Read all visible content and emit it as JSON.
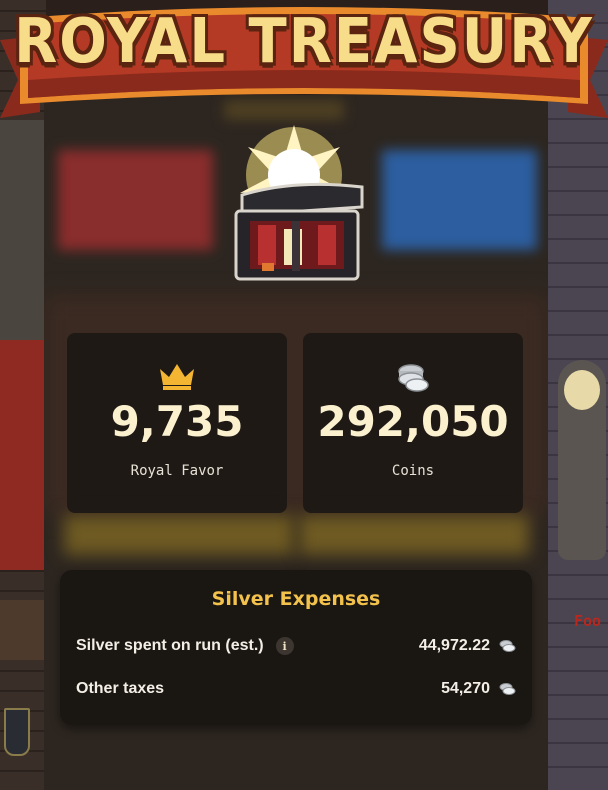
{
  "banner": {
    "title": "ROYAL TREASURY"
  },
  "stats": {
    "favor": {
      "value": "9,735",
      "label": "Royal Favor",
      "icon": "crown-icon"
    },
    "coins": {
      "value": "292,050",
      "label": "Coins",
      "icon": "silver-coins-icon"
    }
  },
  "expenses": {
    "title": "Silver Expenses",
    "rows": [
      {
        "label": "Silver spent on run (est.)",
        "value": "44,972.22",
        "has_info": true
      },
      {
        "label": "Other taxes",
        "value": "54,270",
        "has_info": false
      }
    ]
  },
  "world": {
    "sign_text": "Foo"
  },
  "colors": {
    "accent_gold": "#f3c24c",
    "banner_red": "#b53a25",
    "banner_orange": "#e98a2c",
    "card_bg": "#1c1814"
  }
}
